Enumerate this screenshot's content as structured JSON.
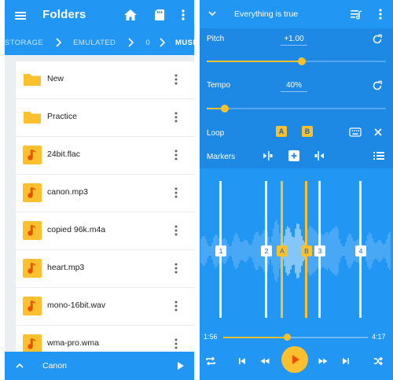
{
  "left": {
    "title": "Folders",
    "icons": [
      "menu-icon",
      "home-icon",
      "sd-card-icon",
      "more-vert-icon"
    ],
    "breadcrumbs": [
      "STORAGE",
      "EMULATED",
      "0",
      "MUSIC"
    ],
    "files": [
      {
        "name": "New",
        "type": "folder"
      },
      {
        "name": "Practice",
        "type": "folder"
      },
      {
        "name": "24bit.flac",
        "type": "audio"
      },
      {
        "name": "canon.mp3",
        "type": "audio"
      },
      {
        "name": "copied 96k.m4a",
        "type": "audio"
      },
      {
        "name": "heart.mp3",
        "type": "audio"
      },
      {
        "name": "mono-16bit.wav",
        "type": "audio"
      },
      {
        "name": "wma-pro.wma",
        "type": "audio"
      }
    ],
    "now_playing": "Canon",
    "colors": {
      "primary": "#2196f3",
      "folder": "#fbc02d"
    }
  },
  "right": {
    "track_title": "Everything is true",
    "pitch": {
      "label": "Pitch",
      "value": "+1.00",
      "slider_fraction": 0.53
    },
    "tempo": {
      "label": "Tempo",
      "value": "40%",
      "slider_fraction": 0.1
    },
    "loop": {
      "label": "Loop",
      "a": "A",
      "b": "B"
    },
    "markers_label": "Markers",
    "markers": [
      "1",
      "2",
      "A",
      "B",
      "3",
      "4"
    ],
    "time_current": "1:56",
    "time_total": "4:17",
    "seek_fraction": 0.44,
    "colors": {
      "accent": "#fbc02d",
      "panel": "#1e88e5"
    }
  }
}
